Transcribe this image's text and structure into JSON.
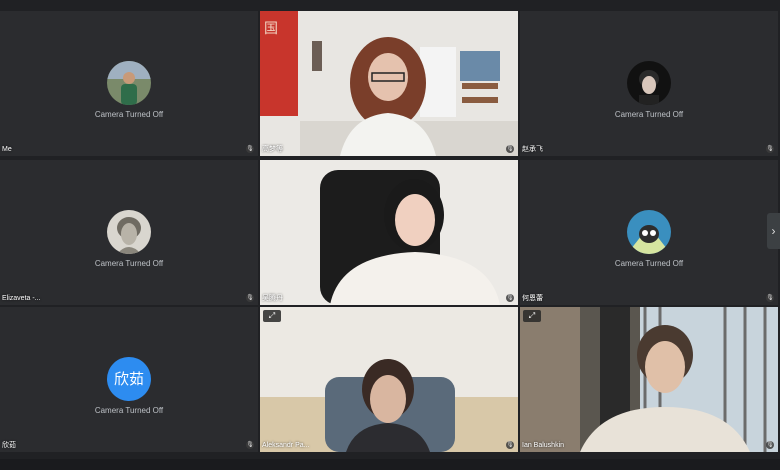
{
  "tiles": {
    "me": {
      "name": "Me",
      "status": "Camera Turned Off"
    },
    "t2": {
      "name": "高梦等"
    },
    "t3": {
      "name": "赵承飞",
      "status": "Camera Turned Off"
    },
    "t4": {
      "name": "Elizaveta -...",
      "status": "Camera Turned Off"
    },
    "t5": {
      "name": "吴腾丹"
    },
    "t6": {
      "name": "何恩蕾",
      "status": "Camera Turned Off"
    },
    "t7": {
      "name": "欣茹",
      "status": "Camera Turned Off",
      "avatar_text": "欣茹"
    },
    "t8": {
      "name": "Aleksandr Pa..."
    },
    "t9": {
      "name": "Ian Balushkin"
    }
  },
  "icons": {
    "mic": "microphone-icon",
    "expand": "expand-icon",
    "next": "chevron-right-icon"
  },
  "colors": {
    "background": "#202124",
    "tile": "#2b2c2f",
    "avatar_blue": "#2d8cf0",
    "status_text": "#bdc1c6"
  }
}
